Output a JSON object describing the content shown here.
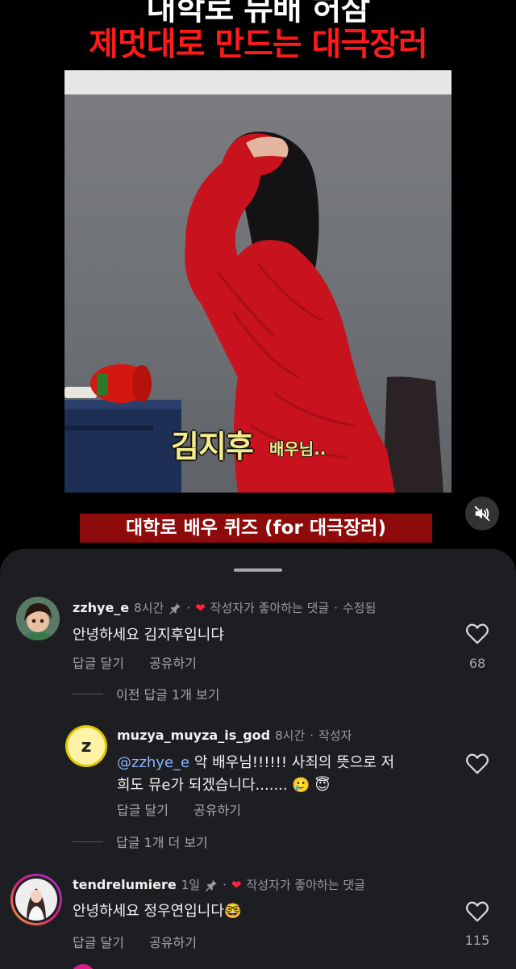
{
  "video": {
    "title_line1": "대학로 뮤배 허참",
    "title_line2": "제멋대로 만드는 대극장러",
    "subtitle_name": "김지후",
    "subtitle_suffix": "배우님..",
    "quiz_banner": "대학로 배우 퀴즈 (for 대극장러)"
  },
  "comments": [
    {
      "username": "zzhye_e",
      "time": "8시간",
      "liked_by_author": "작성자가 좋아하는 댓글",
      "edited": "수정됨",
      "text": "안녕하세요 김지후입니댜",
      "reply_label": "답글 달기",
      "share_label": "공유하기",
      "likes": "68",
      "view_previous": "이전 답글 1개 보기"
    },
    {
      "username": "muzya_muyza_is_god",
      "time": "8시간",
      "author_label": "작성자",
      "mention": "@zzhye_e",
      "text_line1": " 악 배우님!!!!!! 사죄의 뜻으로 저",
      "text_line2": "희도 뮤e가 되겠습니다.......",
      "reply_label": "답글 달기",
      "share_label": "공유하기",
      "view_more": "답글 1개 더 보기"
    },
    {
      "username": "tendrelumiere",
      "time": "1일",
      "liked_by_author": "작성자가 좋아하는 댓글",
      "text": "안녕하세요 정우연입니다",
      "reply_label": "답글 달기",
      "share_label": "공유하기",
      "likes": "115"
    }
  ],
  "icons": {
    "mute": "speaker-muted-icon",
    "pin": "pin-icon",
    "heart_filled": "heart-icon",
    "like": "heart-outline-icon"
  },
  "colors": {
    "title_red": "#ff1a1a",
    "banner_red": "#8e0b0b",
    "subtitle_yellow": "#f4ec8c",
    "sheet_bg": "#1d1e21",
    "heart": "#ff2442"
  }
}
